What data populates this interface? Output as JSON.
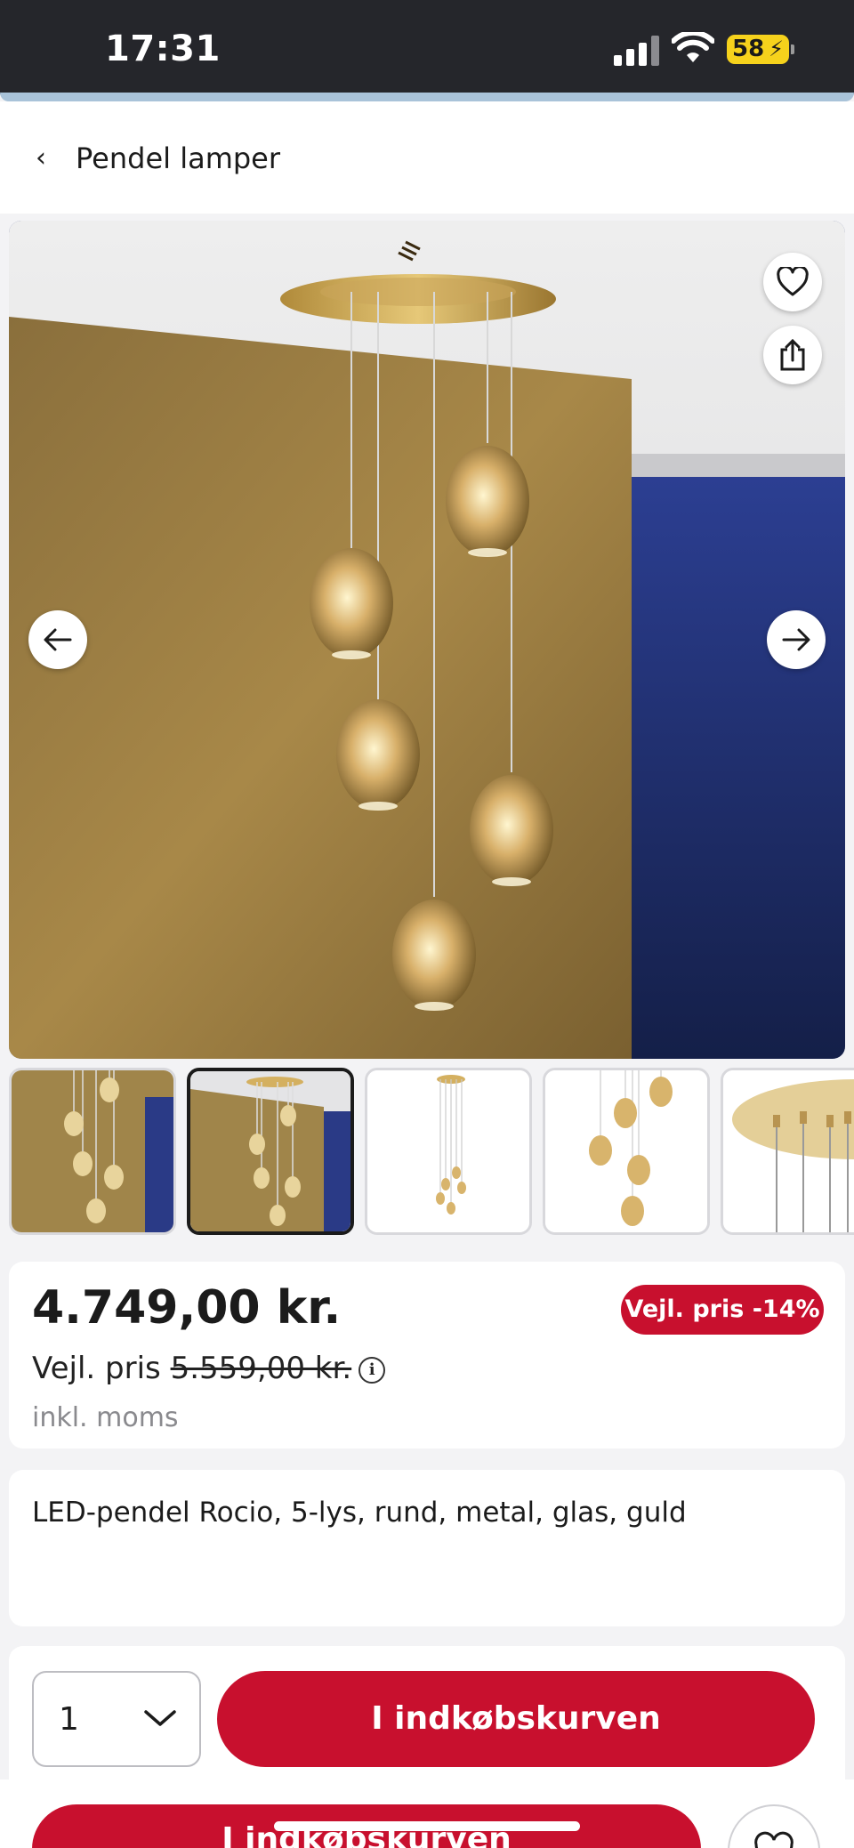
{
  "status_bar": {
    "time": "17:31",
    "battery": "58"
  },
  "header": {
    "back_icon": "chevron-left",
    "title": "Pendel lamper"
  },
  "gallery": {
    "favorite_icon": "heart-icon",
    "share_icon": "share-icon",
    "prev_icon": "arrow-left-icon",
    "next_icon": "arrow-right-icon",
    "selected_thumbnail": 2,
    "thumbnail_count": 5
  },
  "price": {
    "current": "4.749,00 kr.",
    "rrp_label": "Vejl. pris",
    "rrp_value": "5.559,00 kr.",
    "vat_note": "inkl. moms",
    "discount_badge": "Vejl. pris -14%"
  },
  "product": {
    "title": "LED-pendel Rocio, 5-lys, rund, metal, glas, guld"
  },
  "cart": {
    "quantity": "1",
    "add_button": "I indkøbskurven",
    "sticky_add_button": "I indkøbskurven"
  },
  "colors": {
    "brand_red": "#c8102e",
    "status_bar": "#25262b",
    "battery": "#f6d21c"
  }
}
